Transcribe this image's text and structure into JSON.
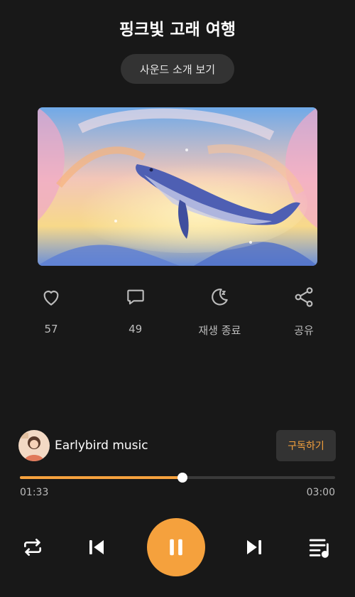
{
  "header": {
    "title": "핑크빛 고래 여행",
    "intro_button": "사운드 소개 보기"
  },
  "actions": [
    {
      "icon": "heart-icon",
      "label": "57"
    },
    {
      "icon": "comment-icon",
      "label": "49"
    },
    {
      "icon": "moon-sleep-icon",
      "label": "재생 종료"
    },
    {
      "icon": "share-icon",
      "label": "공유"
    }
  ],
  "artist": {
    "name": "Earlybird music",
    "subscribe_label": "구독하기"
  },
  "player": {
    "current_time": "01:33",
    "total_time": "03:00",
    "progress": 0.515
  },
  "controls": {
    "repeat": "repeat-icon",
    "previous": "skip-previous-icon",
    "play_state": "pause-icon",
    "next": "skip-next-icon",
    "playlist": "playlist-icon"
  },
  "colors": {
    "accent": "#f5a13d",
    "background": "#181818",
    "surface": "#333333"
  }
}
